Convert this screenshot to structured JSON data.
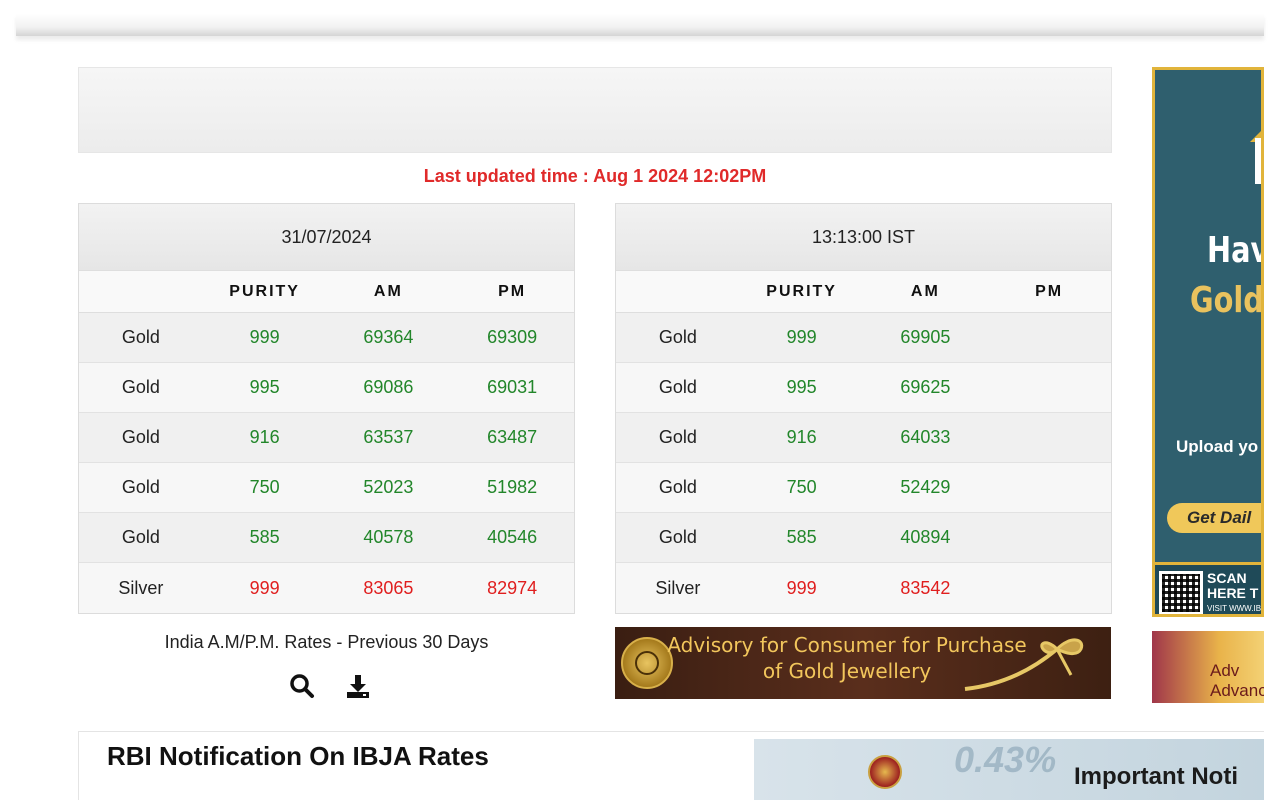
{
  "last_updated": "Last updated time : Aug 1 2024 12:02PM",
  "left_table": {
    "header": "31/07/2024",
    "columns": [
      "",
      "PURITY",
      "AM",
      "PM"
    ],
    "rows": [
      {
        "metal": "Gold",
        "purity": "999",
        "am": "69364",
        "pm": "69309"
      },
      {
        "metal": "Gold",
        "purity": "995",
        "am": "69086",
        "pm": "69031"
      },
      {
        "metal": "Gold",
        "purity": "916",
        "am": "63537",
        "pm": "63487"
      },
      {
        "metal": "Gold",
        "purity": "750",
        "am": "52023",
        "pm": "51982"
      },
      {
        "metal": "Gold",
        "purity": "585",
        "am": "40578",
        "pm": "40546"
      },
      {
        "metal": "Silver",
        "purity": "999",
        "am": "83065",
        "pm": "82974"
      }
    ]
  },
  "right_table": {
    "header": "13:13:00 IST",
    "columns": [
      "",
      "PURITY",
      "AM",
      "PM"
    ],
    "rows": [
      {
        "metal": "Gold",
        "purity": "999",
        "am": "69905",
        "pm": ""
      },
      {
        "metal": "Gold",
        "purity": "995",
        "am": "69625",
        "pm": ""
      },
      {
        "metal": "Gold",
        "purity": "916",
        "am": "64033",
        "pm": ""
      },
      {
        "metal": "Gold",
        "purity": "750",
        "am": "52429",
        "pm": ""
      },
      {
        "metal": "Gold",
        "purity": "585",
        "am": "40894",
        "pm": ""
      },
      {
        "metal": "Silver",
        "purity": "999",
        "am": "83542",
        "pm": ""
      }
    ]
  },
  "previous_link": "India A.M/P.M. Rates - Previous 30 Days",
  "tools": {
    "search_icon": "search-icon",
    "download_icon": "download-icon"
  },
  "advisory_banner": {
    "line1": "Advisory for Consumer for Purchase",
    "line2": "of Gold Jewellery"
  },
  "side_ad": {
    "have": "Have",
    "gold": "Gold",
    "upload": "Upload yo",
    "get_daily": "Get Dail",
    "scan_line1": "SCAN",
    "scan_line2": "HERE T",
    "visit": "VISIT WWW.IB"
  },
  "side_ad2": {
    "line1": "Adv",
    "line2": "Advanc"
  },
  "rbi_section": {
    "title": "RBI Notification On IBJA Rates"
  },
  "important_banner": {
    "title": "Important Noti",
    "bg_number": "0.43%"
  },
  "colors": {
    "green": "#22862a",
    "red": "#e01e1e",
    "accent_red": "#e02a2a"
  }
}
